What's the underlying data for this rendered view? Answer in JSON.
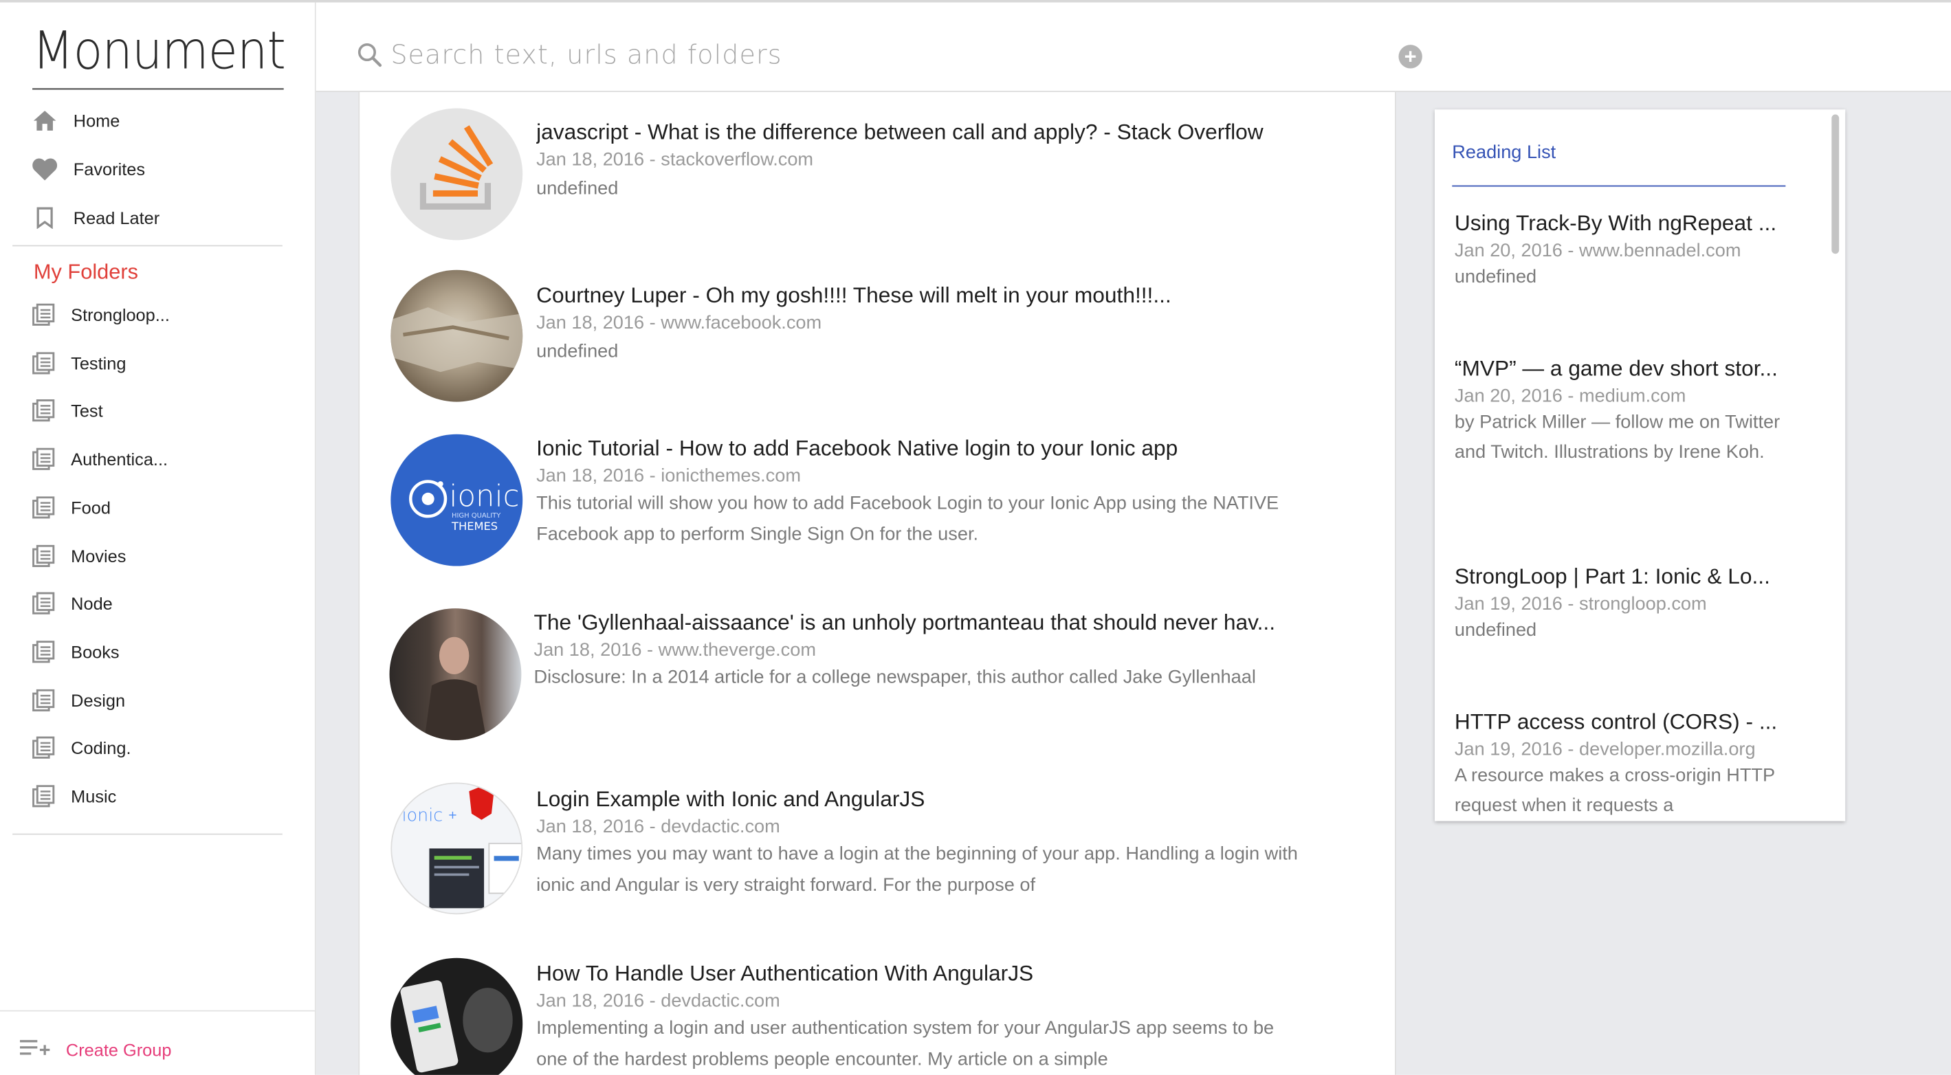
{
  "app": {
    "name": "Monument"
  },
  "nav": [
    {
      "label": "Home",
      "icon": "home-icon"
    },
    {
      "label": "Favorites",
      "icon": "heart-icon"
    },
    {
      "label": "Read Later",
      "icon": "bookmark-icon"
    }
  ],
  "folders": {
    "title": "My Folders",
    "items": [
      "Strongloop...",
      "Testing",
      "Test",
      "Authentica...",
      "Food",
      "Movies",
      "Node",
      "Books",
      "Design",
      "Coding.",
      "Music"
    ]
  },
  "create_group": {
    "label": "Create Group"
  },
  "search": {
    "placeholder": "Search text, urls and folders",
    "value": ""
  },
  "feed": [
    {
      "title": "javascript - What is the difference between call and apply? - Stack Overflow",
      "meta": "Jan 18, 2016 - stackoverflow.com",
      "desc": "undefined",
      "thumb": "stackoverflow-logo"
    },
    {
      "title": "Courtney Luper - Oh my gosh!!!! These will melt in your mouth!!!...",
      "meta": "Jan 18, 2016 - www.facebook.com",
      "desc": "undefined",
      "thumb": "food-photo"
    },
    {
      "title": "Ionic Tutorial - How to add Facebook Native login to your Ionic app",
      "meta": "Jan 18, 2016 - ionicthemes.com",
      "desc": "This tutorial will show you how to add Facebook Login to your Ionic App using the NATIVE Facebook app to perform Single Sign On for the user.",
      "thumb": "ionic-themes-logo",
      "thumb_text": "ionic",
      "thumb_sub": "HIGH QUALITY",
      "thumb_sub2": "THEMES"
    },
    {
      "title": "The 'Gyllenhaal-aissaance' is an unholy portmanteau that should never hav...",
      "meta": "Jan 18, 2016 - www.theverge.com",
      "desc": "Disclosure: In a 2014 article for a college newspaper, this author called Jake Gyllenhaal",
      "thumb": "person-photo"
    },
    {
      "title": "Login Example with Ionic and AngularJS",
      "meta": "Jan 18, 2016 - devdactic.com",
      "desc": "Many times you may want to have a login at the beginning of your app. Handling a login with ionic and Angular is very straight forward. For the purpose of",
      "thumb": "ionic-angular-screenshot",
      "thumb_text": "ionic",
      "thumb_plus": "+"
    },
    {
      "title": "How To Handle User Authentication With AngularJS",
      "meta": "Jan 18, 2016 - devdactic.com",
      "desc": "Implementing a login and user authentication system for your AngularJS app seems to be one of the hardest problems people encounter. My article on a simple",
      "thumb": "phone-photo"
    }
  ],
  "reading_list": {
    "title": "Reading List",
    "items": [
      {
        "title": "Using Track-By With ngRepeat ...",
        "meta": "Jan 20, 2016 - www.bennadel.com",
        "desc": "undefined"
      },
      {
        "title": "“MVP” — a game dev short stor...",
        "meta": "Jan 20, 2016 - medium.com",
        "desc": "by Patrick Miller — follow me on Twitter and Twitch. Illustrations by Irene Koh."
      },
      {
        "title": "StrongLoop | Part 1: Ionic & Lo...",
        "meta": "Jan 19, 2016 - strongloop.com",
        "desc": "undefined"
      },
      {
        "title": "HTTP access control (CORS) - ...",
        "meta": "Jan 19, 2016 - developer.mozilla.org",
        "desc": "A resource makes a cross-origin HTTP request when it requests a"
      }
    ]
  },
  "colors": {
    "folders_title": "#e0403a",
    "create_group": "#e63d7a",
    "reading_list_accent": "#3553b5",
    "stackoverflow_orange": "#f48024",
    "ionic_blue": "#2f64c9"
  }
}
